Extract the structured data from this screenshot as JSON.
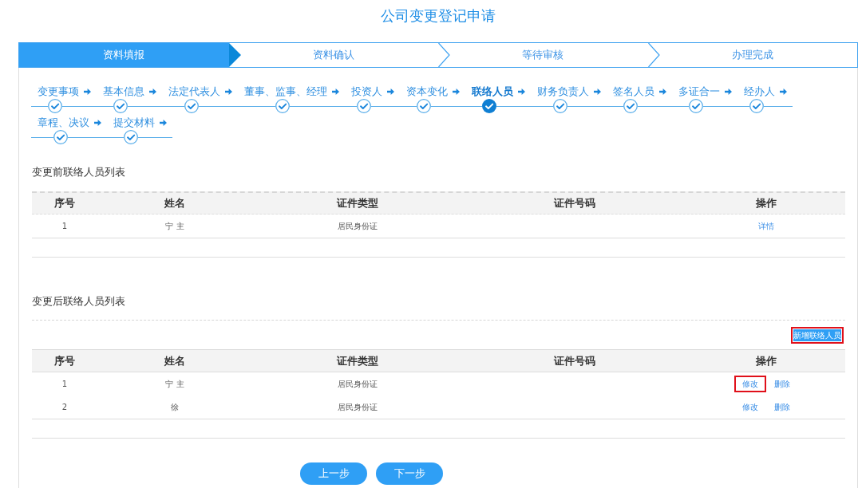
{
  "page_title": "公司变更登记申请",
  "progress_steps": [
    {
      "label": "资料填报",
      "selected": true
    },
    {
      "label": "资料确认",
      "selected": false
    },
    {
      "label": "等待审核",
      "selected": false
    },
    {
      "label": "办理完成",
      "selected": false
    }
  ],
  "sub_steps": [
    {
      "label": "变更事项",
      "completed": true,
      "selected": false
    },
    {
      "label": "基本信息",
      "completed": true,
      "selected": false
    },
    {
      "label": "法定代表人",
      "completed": true,
      "selected": false
    },
    {
      "label": "董事、监事、经理",
      "completed": true,
      "selected": false
    },
    {
      "label": "投资人",
      "completed": true,
      "selected": false
    },
    {
      "label": "资本变化",
      "completed": true,
      "selected": false
    },
    {
      "label": "联络人员",
      "completed": true,
      "selected": true
    },
    {
      "label": "财务负责人",
      "completed": true,
      "selected": false
    },
    {
      "label": "签名人员",
      "completed": true,
      "selected": false
    },
    {
      "label": "多证合一",
      "completed": true,
      "selected": false
    },
    {
      "label": "经办人",
      "completed": true,
      "selected": false
    },
    {
      "label": "章程、决议",
      "completed": true,
      "selected": false
    },
    {
      "label": "提交材料",
      "completed": true,
      "selected": false
    }
  ],
  "before_section": {
    "title": "变更前联络人员列表",
    "columns": [
      "序号",
      "姓名",
      "证件类型",
      "证件号码",
      "操作"
    ],
    "rows": [
      {
        "index": "1",
        "name": "宁 主",
        "id_type": "居民身份证",
        "actions": [
          {
            "label": "详情",
            "highlighted": false
          }
        ]
      }
    ]
  },
  "after_section": {
    "title": "变更后联络人员列表",
    "add_button": {
      "label": "新增联络人员",
      "highlighted": true
    },
    "columns": [
      "序号",
      "姓名",
      "证件类型",
      "证件号码",
      "操作"
    ],
    "rows": [
      {
        "index": "1",
        "name": "宁 主",
        "id_type": "居民身份证",
        "actions": [
          {
            "label": "修改",
            "highlighted": true
          },
          {
            "label": "删除",
            "highlighted": false
          }
        ]
      },
      {
        "index": "2",
        "name": "徐",
        "id_type": "居民身份证",
        "actions": [
          {
            "label": "修改",
            "highlighted": false
          },
          {
            "label": "删除",
            "highlighted": false
          }
        ]
      }
    ]
  },
  "nav_buttons": [
    {
      "label": "上一步"
    },
    {
      "label": "下一步"
    }
  ]
}
